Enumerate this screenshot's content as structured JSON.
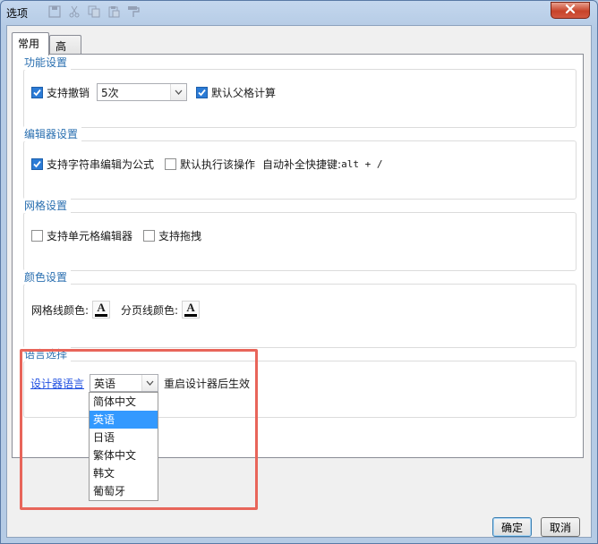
{
  "window": {
    "title": "选项"
  },
  "tabs": [
    {
      "label": "常用",
      "active": true
    },
    {
      "label": "高级",
      "active": false
    }
  ],
  "function_settings": {
    "title": "功能设置",
    "undo_label": "支持撤销",
    "undo_checked": true,
    "undo_steps_value": "5次",
    "parent_calc_label": "默认父格计算",
    "parent_calc_checked": true
  },
  "editor_settings": {
    "title": "编辑器设置",
    "string_formula_label": "支持字符串编辑为公式",
    "string_formula_checked": true,
    "default_execute_label": "默认执行该操作",
    "default_execute_checked": false,
    "autocomplete_label": "自动补全快捷键:",
    "autocomplete_shortcut": "alt + /"
  },
  "grid_settings": {
    "title": "网格设置",
    "cell_editor_label": "支持单元格编辑器",
    "cell_editor_checked": false,
    "drag_label": "支持拖拽",
    "drag_checked": false
  },
  "color_settings": {
    "title": "颜色设置",
    "grid_line_color_label": "网格线颜色:",
    "page_line_color_label": "分页线颜色:",
    "swatch_glyph": "A",
    "grid_line_color": "#000000",
    "page_line_color": "#000000"
  },
  "language_settings": {
    "title": "语言选择",
    "designer_language_link": "设计器语言",
    "selected_language": "英语",
    "restart_note": "重启设计器后生效",
    "options": [
      "简体中文",
      "英语",
      "日语",
      "繁体中文",
      "韩文",
      "葡萄牙"
    ],
    "selected_index": 1
  },
  "buttons": {
    "ok": "确定",
    "cancel": "取消"
  },
  "colors": {
    "accent": "#2b7bd6",
    "group_title": "#2a6fb0",
    "highlight": "#e8655a",
    "link": "#1f4fe0",
    "selection": "#3399ff"
  },
  "icons": [
    "save-icon",
    "cut-icon",
    "copy-icon",
    "paste-icon",
    "format-painter-icon",
    "close-icon",
    "checkmark-icon",
    "chevron-down-icon"
  ]
}
